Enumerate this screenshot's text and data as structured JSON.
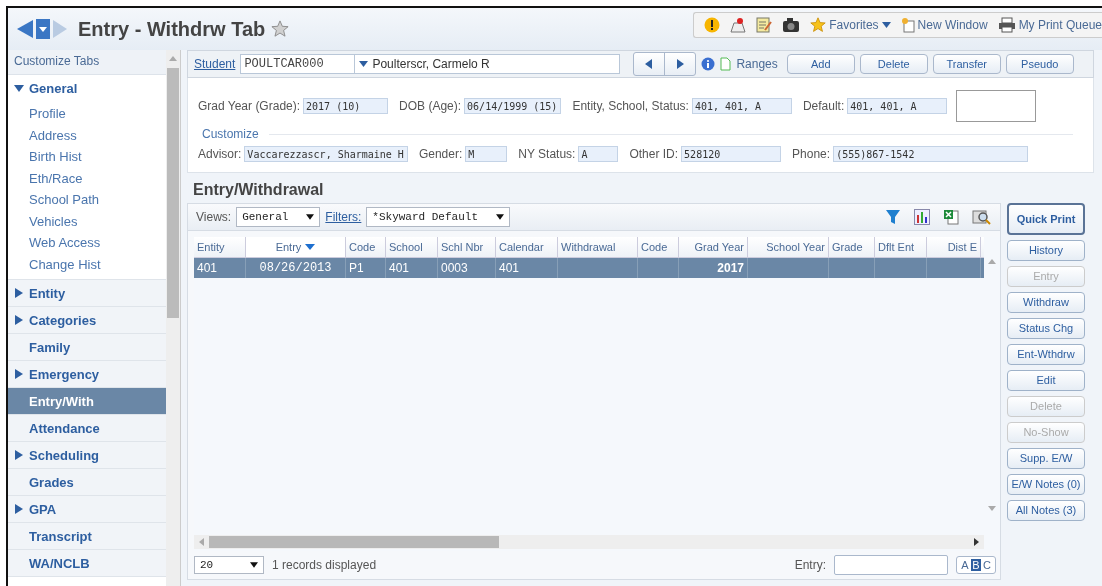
{
  "header": {
    "title": "Entry - Withdrw Tab",
    "links": [
      {
        "label": "Favorites",
        "kind": "favorites"
      },
      {
        "label": "New Window",
        "kind": "window"
      },
      {
        "label": "My Print Queue",
        "kind": "print"
      }
    ]
  },
  "sidebar": {
    "heading": "Customize Tabs",
    "items": [
      {
        "label": "General",
        "kind": "group",
        "expanded": true,
        "selected": false,
        "children": [
          {
            "label": "Profile",
            "selected": false
          },
          {
            "label": "Address",
            "selected": false
          },
          {
            "label": "Birth Hist",
            "selected": false
          },
          {
            "label": "Eth/Race",
            "selected": false
          },
          {
            "label": "School Path",
            "selected": false
          },
          {
            "label": "Vehicles",
            "selected": false
          },
          {
            "label": "Web Access",
            "selected": false
          },
          {
            "label": "Change Hist",
            "selected": false
          }
        ]
      },
      {
        "label": "Entity",
        "kind": "group",
        "expanded": false,
        "selected": false
      },
      {
        "label": "Categories",
        "kind": "group",
        "expanded": false,
        "selected": false
      },
      {
        "label": "Family",
        "kind": "tab",
        "selected": false
      },
      {
        "label": "Emergency",
        "kind": "group",
        "expanded": false,
        "selected": false
      },
      {
        "label": "Entry/With",
        "kind": "tab",
        "selected": true
      },
      {
        "label": "Attendance",
        "kind": "tab",
        "selected": false
      },
      {
        "label": "Scheduling",
        "kind": "group",
        "expanded": false,
        "selected": false
      },
      {
        "label": "Grades",
        "kind": "tab",
        "selected": false
      },
      {
        "label": "GPA",
        "kind": "group",
        "expanded": false,
        "selected": false
      },
      {
        "label": "Transcript",
        "kind": "tab",
        "selected": false
      },
      {
        "label": "WA/NCLB",
        "kind": "tab",
        "selected": false
      }
    ]
  },
  "student": {
    "link": "Student",
    "id": "POULTCAR000",
    "name": "Poulterscr, Carmelo R",
    "ranges": "Ranges",
    "buttons": [
      "Add",
      "Delete",
      "Transfer",
      "Pseudo"
    ]
  },
  "info": {
    "top_fields": [
      {
        "label": "Grad Year (Grade):",
        "value": "2017 (10)"
      },
      {
        "label": "DOB (Age):",
        "value": "06/14/1999 (15)"
      },
      {
        "label": "Entity, School, Status:",
        "value": "401, 401, A"
      },
      {
        "label": "Default:",
        "value": "401, 401, A"
      }
    ],
    "customize": "Customize",
    "bottom_fields": [
      {
        "label": "Advisor:",
        "value": "Vaccarezzascr, Sharmaine H"
      },
      {
        "label": "Gender:",
        "value": "M"
      },
      {
        "label": "NY Status:",
        "value": "A"
      },
      {
        "label": "Other ID:",
        "value": "528120"
      },
      {
        "label": "Phone:",
        "value": "(555)867-1542"
      }
    ]
  },
  "section": {
    "title": "Entry/Withdrawal",
    "views_label": "Views:",
    "view": "General",
    "filters_label": "Filters:",
    "filter": "*Skyward Default"
  },
  "table": {
    "columns": [
      {
        "label": "Entity",
        "sorted": false
      },
      {
        "label": "Entry",
        "sorted": true
      },
      {
        "label": "Code",
        "sorted": false
      },
      {
        "label": "School",
        "sorted": false
      },
      {
        "label": "Schl Nbr",
        "sorted": false
      },
      {
        "label": "Calendar",
        "sorted": false
      },
      {
        "label": "Withdrawal",
        "sorted": false
      },
      {
        "label": "Code",
        "sorted": false
      },
      {
        "label": "Grad Year",
        "sorted": false
      },
      {
        "label": "School Year",
        "sorted": false
      },
      {
        "label": "Grade",
        "sorted": false
      },
      {
        "label": "Dflt Ent",
        "sorted": false
      },
      {
        "label": "Dist E",
        "sorted": false
      }
    ],
    "rows": [
      {
        "selected": true,
        "cells": [
          "401",
          "08/26/2013",
          "P1",
          "401",
          "0003",
          "401",
          null,
          null,
          "2017",
          null,
          null,
          null,
          null
        ]
      }
    ]
  },
  "footer": {
    "page_size": "20",
    "records": "1 records displayed",
    "entry_label": "Entry:",
    "letters": [
      {
        "label": "A",
        "selected": false
      },
      {
        "label": "B",
        "selected": true
      },
      {
        "label": "C",
        "selected": false
      }
    ]
  },
  "side_buttons": [
    {
      "label": "Quick Print",
      "primary": true,
      "disabled": false
    },
    {
      "label": "History",
      "primary": false,
      "disabled": false
    },
    {
      "label": "Entry",
      "primary": false,
      "disabled": true
    },
    {
      "label": "Withdraw",
      "primary": false,
      "disabled": false
    },
    {
      "label": "Status Chg",
      "primary": false,
      "disabled": false
    },
    {
      "label": "Ent-Wthdrw",
      "primary": false,
      "disabled": false
    },
    {
      "label": "Edit",
      "primary": false,
      "disabled": false
    },
    {
      "label": "Delete",
      "primary": false,
      "disabled": true
    },
    {
      "label": "No-Show",
      "primary": false,
      "disabled": true
    },
    {
      "label": "Supp. E/W",
      "primary": false,
      "disabled": false
    },
    {
      "label": "E/W Notes (0)",
      "primary": false,
      "disabled": false
    },
    {
      "label": "All Notes (3)",
      "primary": false,
      "disabled": false
    }
  ]
}
